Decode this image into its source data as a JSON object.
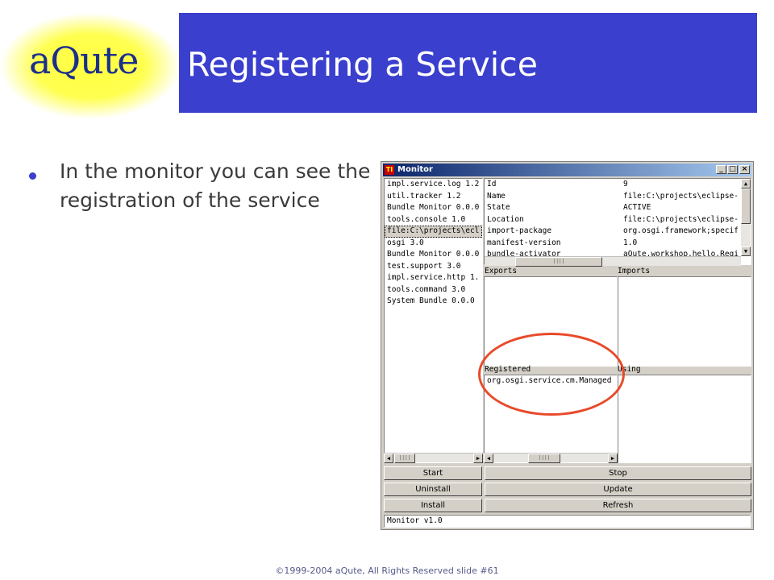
{
  "logo": {
    "text": "aQute"
  },
  "slide": {
    "title": "Registering a Service",
    "bullet": "In the monitor you can see the registration of the service",
    "footer": "©1999-2004 aQute, All Rights Reserved slide #61"
  },
  "monitor": {
    "window_title": "Monitor",
    "app_icon": "TI",
    "controls": {
      "minimize": "_",
      "maximize": "□",
      "close": "×"
    },
    "bundles": [
      "impl.service.log 1.2",
      "util.tracker 1.2",
      "Bundle Monitor 0.0.0",
      "tools.console 1.0",
      "file:C:\\projects\\ecl",
      "osgi 3.0",
      "Bundle Monitor 0.0.0",
      "test.support 3.0",
      "impl.service.http 1.",
      "tools.command 3.0",
      "System Bundle 0.0.0"
    ],
    "selected_bundle_index": 4,
    "properties": [
      {
        "key": "Id",
        "value": "9"
      },
      {
        "key": "Name",
        "value": "file:C:\\projects\\eclipse-"
      },
      {
        "key": "State",
        "value": "ACTIVE"
      },
      {
        "key": "Location",
        "value": "file:C:\\projects\\eclipse-"
      },
      {
        "key": "import-package",
        "value": "org.osgi.framework;specif"
      },
      {
        "key": "manifest-version",
        "value": "1.0"
      },
      {
        "key": "bundle-activator",
        "value": "aQute.workshop.hello.Regi"
      }
    ],
    "labels": {
      "exports": "Exports",
      "imports": "Imports",
      "registered": "Registered",
      "using": "Using"
    },
    "registered": [
      "org.osgi.service.cm.Managed"
    ],
    "buttons": {
      "start": "Start",
      "stop": "Stop",
      "uninstall": "Uninstall",
      "update": "Update",
      "install": "Install",
      "refresh": "Refresh"
    },
    "status": "Monitor v1.0"
  },
  "colors": {
    "title_bar": "#3a3fce",
    "highlight": "#e84a2a",
    "logo_text": "#1c2f8c"
  }
}
